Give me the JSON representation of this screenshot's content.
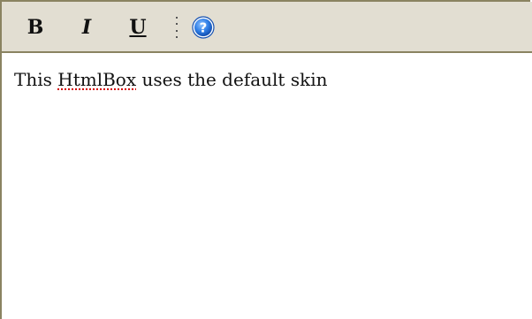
{
  "toolbar": {
    "bold_label": "B",
    "italic_label": "I",
    "underline_label": "U",
    "help_icon": "help-icon"
  },
  "editor": {
    "text_before": "This ",
    "misspelled_word": "HtmlBox",
    "text_after": " uses the default skin"
  },
  "colors": {
    "toolbar_bg": "#e2ded2",
    "border": "#8a8361",
    "help_blue": "#1e6fd9",
    "spellcheck_red": "#d40000"
  }
}
